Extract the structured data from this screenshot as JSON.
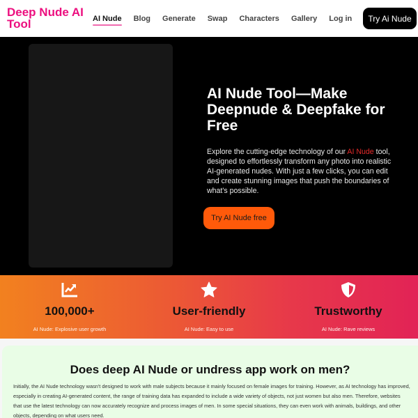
{
  "header": {
    "logo": "Deep Nude AI Tool",
    "nav": [
      {
        "label": "AI Nude",
        "active": true
      },
      {
        "label": "Blog"
      },
      {
        "label": "Generate"
      },
      {
        "label": "Swap"
      },
      {
        "label": "Characters"
      },
      {
        "label": "Gallery"
      },
      {
        "label": "Log in"
      }
    ],
    "cta": "Try Ai Nude"
  },
  "hero": {
    "title": "AI Nude Tool—Make Deepnude & Deepfake for Free",
    "desc_before": "Explore the cutting-edge technology of our ",
    "desc_highlight": "AI Nude",
    "desc_after": " tool, designed to effortlessly transform any photo into realistic AI-generated nudes. With just a few clicks, you can edit and create stunning images that push the boundaries of what's possible.",
    "cta": "Try AI Nude free",
    "accent_color": "#ff5a0a",
    "highlight_color": "#e52a2a"
  },
  "stats": [
    {
      "icon": "chart-trend-icon",
      "value": "100,000+",
      "caption": "AI Nude: Explosive user growth"
    },
    {
      "icon": "star-icon",
      "value": "User-friendly",
      "caption": "AI Nude: Easy to use"
    },
    {
      "icon": "shield-icon",
      "value": "Trustworthy",
      "caption": "AI Nude: Rave reviews"
    }
  ],
  "faq": {
    "title": "Does deep AI Nude or undress app work on men?",
    "body": "Initially, the AI Nude technology wasn't designed to work with male subjects because it mainly focused on female images for training. However, as AI technology has improved, especially in creating AI-generated content, the range of training data has expanded to include a wide variety of objects, not just women but also men. Therefore, websites that use the latest technology can now accurately recognize and process images of men. In some special situations, they can even work with animals, buildings, and other objects, depending on what users need."
  },
  "colors": {
    "brand_pink": "#ec0f7f",
    "gradient_start": "#f2811f",
    "gradient_end": "#e22356",
    "faq_bg": "#e9fde6"
  }
}
